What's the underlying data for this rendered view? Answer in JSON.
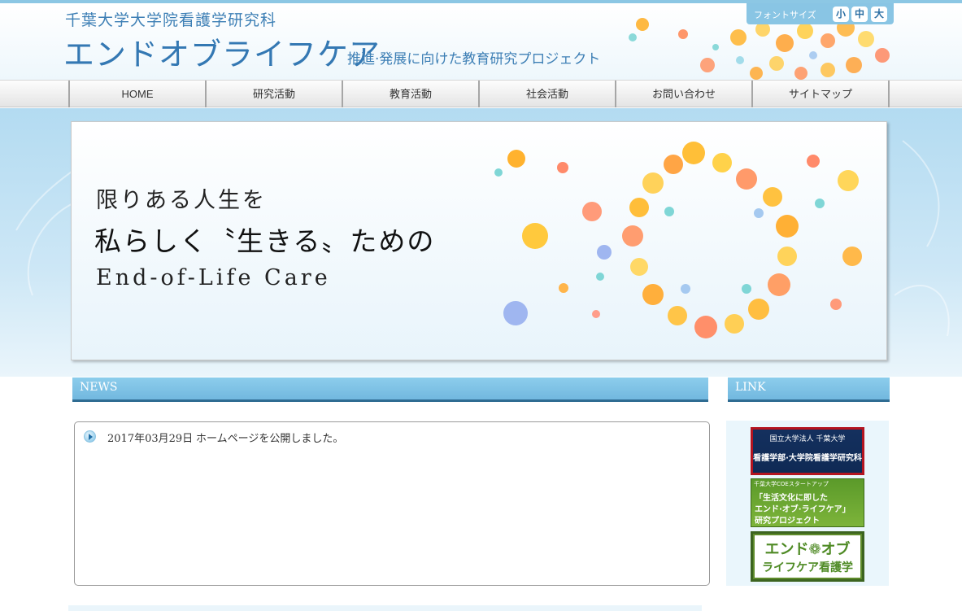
{
  "header": {
    "subtitle": "千葉大学大学院看護学研究科",
    "title": "エンドオブライフケア",
    "tagline": "推進·発展に向けた教育研究プロジェクト",
    "font_size_label": "フォントサイズ",
    "font_sizes": [
      "小",
      "中",
      "大"
    ]
  },
  "nav": {
    "items": [
      "HOME",
      "研究活動",
      "教育活動",
      "社会活動",
      "お問い合わせ",
      "サイトマップ"
    ]
  },
  "hero": {
    "line1": "限りある人生を",
    "line2": "私らしく〝生きる〟ための",
    "line3": "End-of-Life Care"
  },
  "news": {
    "title": "NEWS",
    "items": [
      {
        "date": "2017年03月29日",
        "text": "ホームページを公開しました。"
      }
    ]
  },
  "links": {
    "title": "LINK",
    "banners": [
      {
        "top": "国立大学法人 千葉大学",
        "bottom": "看護学部·大学院看護学研究科"
      },
      {
        "top": "千葉大学COEスタートアップ",
        "line1": "「生活文化に即した",
        "line2": "エンド·オブ·ライフケア」",
        "line3": "研究プロジェクト"
      },
      {
        "line1": "エンド❁オブ",
        "line2": "ライフケア看護学"
      }
    ]
  },
  "colors": {
    "accent": "#3478b3",
    "bar": "#7fc2e6",
    "bar_border": "#2f6c92",
    "hero_bg": "#b3dbf1"
  }
}
